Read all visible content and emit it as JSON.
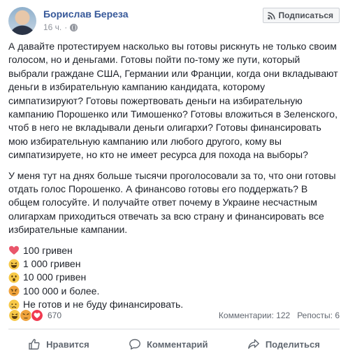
{
  "header": {
    "author": "Борислав Береза",
    "time": "16 ч.",
    "separator": "·",
    "subscribe_label": "Подписаться"
  },
  "post": {
    "paragraphs": [
      "А давайте протестируем насколько вы готовы рискнуть не только своим голосом, но и деньгами. Готовы пойти по-тому же пути, который выбрали граждане США, Германии или Франции, когда они вкладывают деньги в избирательную кампанию кандидата, которому симпатизируют? Готовы пожертвовать деньги на избирательную кампанию Порошенко или Тимошенко? Готовы вложиться в Зеленского, чтоб в него не вкладывали деньги олигархи? Готовы финансировать мою избирательную кампанию или любого другого, кому вы симпатизируете, но кто не имеет ресурса для похода на выборы?",
      "У меня тут на днях больше тысячи проголосовали за то, что они готовы отдать голос Порошенко. А финансово готовы его поддержать? В общем голосуйте. И получайте ответ почему в Украине несчастным олигархам приходиться отвечать за всю страну и финансировать все избирательные кампании."
    ],
    "options": [
      {
        "icon": "heart-icon",
        "label": "100 гривен"
      },
      {
        "icon": "haha-icon",
        "label": "1 000 гривен"
      },
      {
        "icon": "wow-icon",
        "label": "10 000 гривен"
      },
      {
        "icon": "angry-icon",
        "label": "100 000 и более."
      },
      {
        "icon": "sad-icon",
        "label": "Не готов и не буду финансировать."
      }
    ]
  },
  "reactions": {
    "icons": [
      "haha-icon",
      "angry-icon",
      "love-icon"
    ],
    "count": "670",
    "comments": "Комментарии: 122",
    "shares": "Репосты: 6"
  },
  "actions": {
    "like": "Нравится",
    "comment": "Комментарий",
    "share": "Поделиться"
  },
  "colors": {
    "link": "#365899",
    "text": "#1d2129",
    "meta": "#90949c",
    "action": "#606770",
    "divider": "#dadde1"
  }
}
